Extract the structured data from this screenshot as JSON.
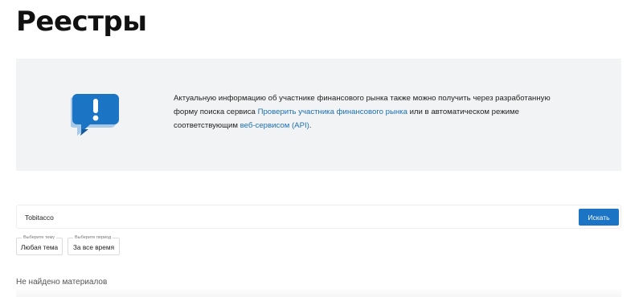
{
  "page": {
    "title": "Реестры"
  },
  "info": {
    "text_before_link1": "Актуальную информацию об участнике финансового рынка также можно получить через разработанную форму поиска сервиса ",
    "link1": "Проверить участника финансового рынка",
    "text_between_links": " или в автоматическом режиме соответствующим ",
    "link2": "веб-сервисом (API)",
    "text_after_link2": ".",
    "icon": "info-speech-bubble-icon"
  },
  "search": {
    "value": "Tobitacco",
    "placeholder": "",
    "button_label": "Искать"
  },
  "filters": {
    "topic": {
      "caption": "Выберите тему",
      "value": "Любая тема"
    },
    "period": {
      "caption": "Выберите период",
      "value": "За все время"
    }
  },
  "results": {
    "empty_message": "Не найдено материалов"
  },
  "colors": {
    "accent": "#1b74c4",
    "link": "#1a6fb5",
    "panel_bg": "#f2f3f4"
  }
}
